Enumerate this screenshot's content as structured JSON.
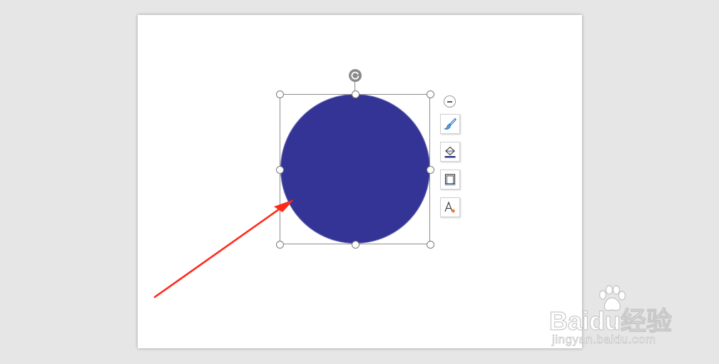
{
  "canvas": {
    "workspace_color": "#e6e6e6",
    "slide_color": "#ffffff"
  },
  "shape": {
    "type": "circle",
    "fill_color": "#343496",
    "selected": true
  },
  "side_toolbar": {
    "items": [
      {
        "icon": "collapse-icon"
      },
      {
        "icon": "paintbrush-icon"
      },
      {
        "icon": "fill-bucket-icon"
      },
      {
        "icon": "outline-frame-icon"
      },
      {
        "icon": "text-effect-icon"
      }
    ]
  },
  "annotation": {
    "arrow_color": "#ff2a1a"
  },
  "watermark": {
    "brand": "Baidu经验",
    "url": "jingyan.baidu.com"
  }
}
